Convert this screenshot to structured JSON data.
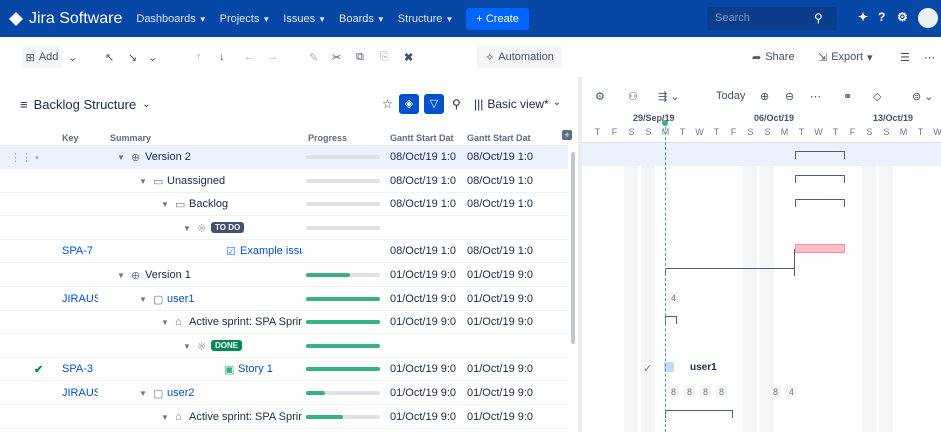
{
  "nav": {
    "app": "Jira Software",
    "items": [
      "Dashboards",
      "Projects",
      "Issues",
      "Boards",
      "Structure"
    ],
    "create": "+ Create",
    "search_placeholder": "Search"
  },
  "toolbar": {
    "add": "Add",
    "automation": "Automation",
    "share": "Share",
    "export": "Export"
  },
  "structure": {
    "title": "Backlog Structure",
    "view": "Basic view*",
    "columns": [
      "Key",
      "Summary",
      "Progress",
      "Gantt Start Dat",
      "Gantt Start Dat"
    ]
  },
  "rows": [
    {
      "key": "",
      "summary": "Version 2",
      "progress": 0,
      "d1": "08/Oct/19 1:0",
      "d2": "08/Oct/19 1:0",
      "indent": 1,
      "icon": "version"
    },
    {
      "key": "",
      "summary": "Unassigned",
      "progress": 0,
      "d1": "08/Oct/19 1:0",
      "d2": "08/Oct/19 1:0",
      "indent": 2,
      "icon": "folder"
    },
    {
      "key": "",
      "summary": "Backlog",
      "progress": 0,
      "d1": "08/Oct/19 1:0",
      "d2": "08/Oct/19 1:0",
      "indent": 3,
      "icon": "folder"
    },
    {
      "key": "",
      "summary": "TO DO",
      "progress": 0,
      "d1": "",
      "d2": "",
      "indent": 4,
      "icon": "status-todo"
    },
    {
      "key": "SPA-7",
      "summary": "Example issu",
      "progress": 0,
      "d1": "08/Oct/19 1:0",
      "d2": "08/Oct/19 1:0",
      "indent": 5,
      "icon": "task"
    },
    {
      "key": "",
      "summary": "Version 1",
      "progress": 60,
      "d1": "01/Oct/19 9:0",
      "d2": "01/Oct/19 9:0",
      "indent": 1,
      "icon": "version"
    },
    {
      "key": "JIRAUS",
      "summary": "user1",
      "progress": 100,
      "d1": "01/Oct/19 9:0",
      "d2": "01/Oct/19 9:0",
      "indent": 2,
      "icon": "user"
    },
    {
      "key": "",
      "summary": "Active sprint: SPA Sprir",
      "progress": 100,
      "d1": "01/Oct/19 9:0",
      "d2": "01/Oct/19 9:0",
      "indent": 3,
      "icon": "sprint"
    },
    {
      "key": "",
      "summary": "DONE",
      "progress": 100,
      "d1": "",
      "d2": "",
      "indent": 4,
      "icon": "status-done"
    },
    {
      "key": "SPA-3",
      "summary": "Story 1",
      "progress": 100,
      "d1": "01/Oct/19 9:0",
      "d2": "01/Oct/19 9:0",
      "indent": 5,
      "icon": "story"
    },
    {
      "key": "JIRAUS",
      "summary": "user2",
      "progress": 25,
      "d1": "01/Oct/19 9:0",
      "d2": "01/Oct/19 9:0",
      "indent": 2,
      "icon": "user"
    },
    {
      "key": "",
      "summary": "Active sprint: SPA Sprir",
      "progress": 50,
      "d1": "01/Oct/19 9:0",
      "d2": "01/Oct/19 9:0",
      "indent": 3,
      "icon": "sprint"
    }
  ],
  "gantt": {
    "today": "Today",
    "weeks": [
      "29/Sep/19",
      "06/Oct/19",
      "13/Oct/19"
    ],
    "days": [
      "T",
      "F",
      "S",
      "S",
      "M",
      "T",
      "W",
      "T",
      "F",
      "S",
      "S",
      "M",
      "T",
      "W",
      "T",
      "F",
      "S",
      "S",
      "M",
      "T",
      "W"
    ],
    "user_label": "user1",
    "counts_row1": [
      "4"
    ],
    "counts_row2": [
      "8",
      "8",
      "8",
      "8",
      "8",
      "4"
    ]
  },
  "colors": {
    "nav": "#0747a6",
    "accent": "#0052cc",
    "done": "#36b37e",
    "conflict": "#ffbdc8"
  }
}
